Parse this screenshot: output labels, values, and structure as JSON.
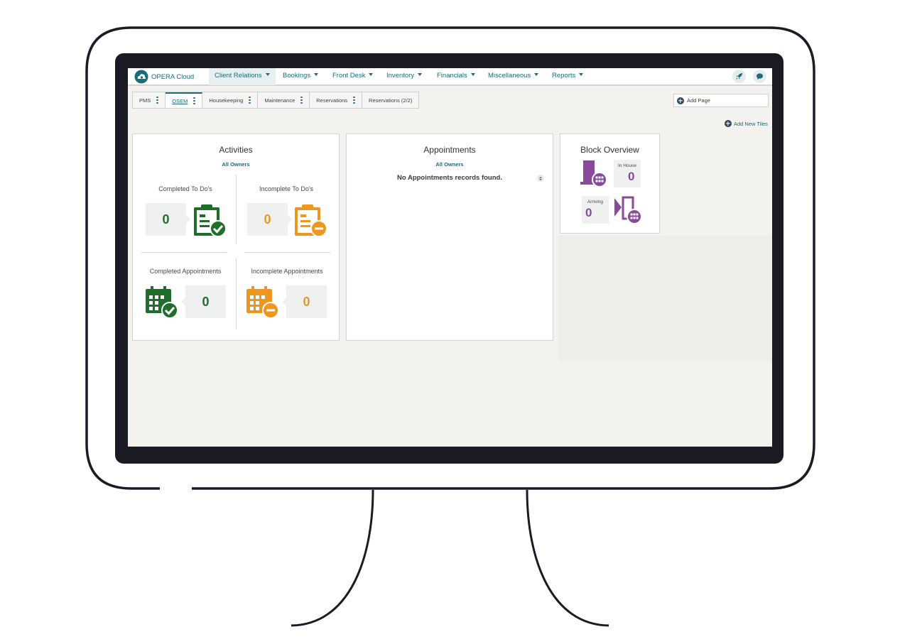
{
  "app": {
    "brand": "OPERA Cloud"
  },
  "nav": {
    "items": [
      {
        "label": "Client Relations",
        "active": true
      },
      {
        "label": "Bookings"
      },
      {
        "label": "Front Desk"
      },
      {
        "label": "Inventory"
      },
      {
        "label": "Financials"
      },
      {
        "label": "Miscellaneous"
      },
      {
        "label": "Reports"
      }
    ],
    "icons": [
      "rocket-icon",
      "chat-icon"
    ]
  },
  "tabs": [
    {
      "label": "PMS"
    },
    {
      "label": "OSEM",
      "active": true
    },
    {
      "label": "Housekeeping"
    },
    {
      "label": "Maintenance"
    },
    {
      "label": "Reservations"
    },
    {
      "label": "Reservations (2/2)"
    }
  ],
  "toolbar": {
    "add_page": "Add Page",
    "add_new_tiles": "Add New Tiles"
  },
  "activities": {
    "title": "Activities",
    "filter": "All Owners",
    "completed_todos": {
      "label": "Completed To Do's",
      "count": "0"
    },
    "incomplete_todos": {
      "label": "Incomplete To Do's",
      "count": "0"
    },
    "completed_appointments": {
      "label": "Completed Appointments",
      "count": "0"
    },
    "incomplete_appointments": {
      "label": "Incomplete Appointments",
      "count": "0"
    }
  },
  "appointments": {
    "title": "Appointments",
    "filter": "All Owners",
    "empty_message": "No Appointments records found."
  },
  "block_overview": {
    "title": "Block Overview",
    "in_house": {
      "label": "In House",
      "count": "0"
    },
    "arriving": {
      "label": "Arriving",
      "count": "0"
    }
  },
  "colors": {
    "brand": "#1a6c7a",
    "success": "#1f6e2a",
    "warning": "#f0961c",
    "block": "#8a4a9b"
  }
}
